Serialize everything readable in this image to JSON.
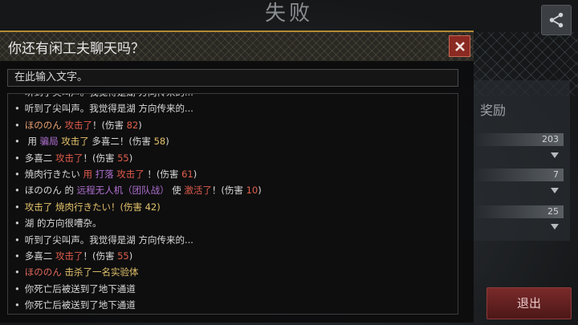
{
  "screen": {
    "title": "失败",
    "reward_label": "奖励",
    "reward_values": [
      "203",
      "7",
      "25"
    ],
    "exit_label": "退出"
  },
  "dialog": {
    "title": "你还有闲工夫聊天吗？",
    "input_placeholder": "在此输入文字。"
  },
  "log": [
    [
      {
        "t": "听到了尖叫声。我觉得是湖 方向传来的...",
        "c": "white"
      }
    ],
    [
      {
        "t": "听到了尖叫声。我觉得是湖 方向传来的...",
        "c": "white"
      }
    ],
    [
      {
        "t": "ほののん",
        "c": "name"
      },
      {
        "t": "  攻击了",
        "c": "red"
      },
      {
        "t": "！(伤害 ",
        "c": "white"
      },
      {
        "t": "82",
        "c": "dmg"
      },
      {
        "t": ")",
        "c": "white"
      }
    ],
    [
      {
        "t": " 用 ",
        "c": "white"
      },
      {
        "t": "骗局",
        "c": "skill"
      },
      {
        "t": " 攻击了 ",
        "c": "gold"
      },
      {
        "t": " 多喜二",
        "c": "white"
      },
      {
        "t": "！(伤害 ",
        "c": "white"
      },
      {
        "t": "58",
        "c": "gold"
      },
      {
        "t": ")",
        "c": "white"
      }
    ],
    [
      {
        "t": "多喜二",
        "c": "white"
      },
      {
        "t": "  攻击了",
        "c": "red"
      },
      {
        "t": "！(伤害 ",
        "c": "white"
      },
      {
        "t": "55",
        "c": "dmg"
      },
      {
        "t": ")",
        "c": "white"
      }
    ],
    [
      {
        "t": "焼肉行きたい",
        "c": "white"
      },
      {
        "t": "  用 ",
        "c": "red"
      },
      {
        "t": "打落",
        "c": "skill"
      },
      {
        "t": " 攻击了",
        "c": "red"
      },
      {
        "t": " ！(伤害 ",
        "c": "white"
      },
      {
        "t": "61",
        "c": "dmg"
      },
      {
        "t": ")",
        "c": "white"
      }
    ],
    [
      {
        "t": "ほののん",
        "c": "white"
      },
      {
        "t": " 的 ",
        "c": "white"
      },
      {
        "t": "远程无人机（团队战）",
        "c": "skill"
      },
      {
        "t": " 使 ",
        "c": "white"
      },
      {
        "t": " 激活了",
        "c": "red"
      },
      {
        "t": "！(伤害 ",
        "c": "white"
      },
      {
        "t": "10",
        "c": "dmg"
      },
      {
        "t": ")",
        "c": "white"
      }
    ],
    [
      {
        "t": "攻击了 焼肉行きたい！(伤害 42)",
        "c": "gold"
      }
    ],
    [
      {
        "t": "湖 的方向很嘈杂。",
        "c": "white"
      }
    ],
    [
      {
        "t": "听到了尖叫声。我觉得是湖 方向传来的...",
        "c": "white"
      }
    ],
    [
      {
        "t": "多喜二",
        "c": "white"
      },
      {
        "t": "  攻击了",
        "c": "red"
      },
      {
        "t": "！(伤害 ",
        "c": "white"
      },
      {
        "t": "55",
        "c": "dmg"
      },
      {
        "t": ")",
        "c": "white"
      }
    ],
    [
      {
        "t": "ほののん",
        "c": "name2"
      },
      {
        "t": "  击杀了一名实验体",
        "c": "gold"
      }
    ],
    [
      {
        "t": "你死亡后被送到了地下通道",
        "c": "white"
      }
    ],
    [
      {
        "t": "你死亡后被送到了地下通道",
        "c": "white"
      }
    ]
  ],
  "colors": {
    "accent_gold": "#b38a33",
    "close_red": "#8a2a22",
    "exit_red": "#7a2a2a"
  },
  "icons": [
    "share-icon",
    "close-icon",
    "chevron-down-icon"
  ]
}
